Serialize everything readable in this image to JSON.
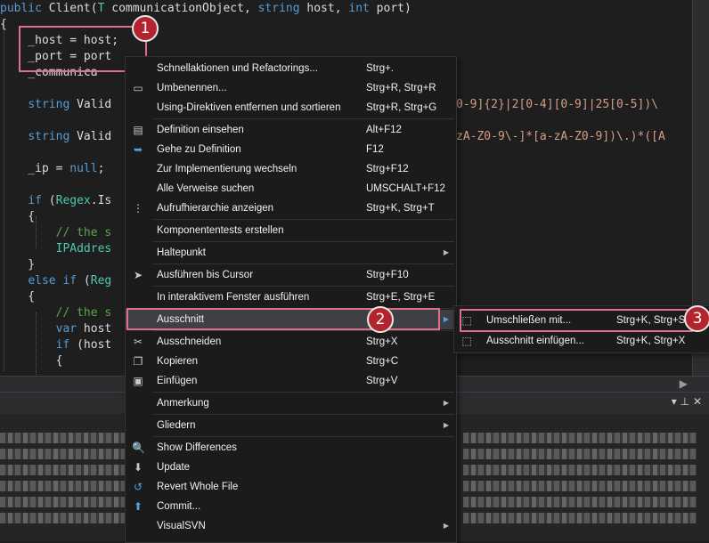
{
  "code": {
    "lines": [
      "public Client(T communicationObject, string host, int port)",
      "{",
      "    _host = host;",
      "    _port = port",
      "    _communica",
      "",
      "    string Valid",
      "",
      "    string Valid",
      "",
      "    _ip = null;",
      "",
      "    if (Regex.Is",
      "    {",
      "        // the s",
      "        IPAddres",
      "    }",
      "    else if (Reg",
      "    {",
      "        // the s",
      "        var host",
      "        if (host",
      "        {"
    ],
    "fragment_regex1": "0-9]{2}|2[0-4][0-9]|25[0-5])\\",
    "fragment_regex2": "zA-Z0-9\\-]*[a-zA-Z0-9])\\.)*([A"
  },
  "context_menu": {
    "items": [
      {
        "label": "Schnellaktionen und Refactorings...",
        "shortcut": "Strg+.",
        "icon": "screwdriver-icon"
      },
      {
        "label": "Umbenennen...",
        "shortcut": "Strg+R, Strg+R",
        "icon": "rename-icon"
      },
      {
        "label": "Using-Direktiven entfernen und sortieren",
        "shortcut": "Strg+R, Strg+G",
        "icon": ""
      },
      {
        "label": "Definition einsehen",
        "shortcut": "Alt+F12",
        "icon": "peek-definition-icon"
      },
      {
        "label": "Gehe zu Definition",
        "shortcut": "F12",
        "icon": "go-to-definition-icon"
      },
      {
        "label": "Zur Implementierung wechseln",
        "shortcut": "Strg+F12",
        "icon": ""
      },
      {
        "label": "Alle Verweise suchen",
        "shortcut": "UMSCHALT+F12",
        "icon": ""
      },
      {
        "label": "Aufrufhierarchie anzeigen",
        "shortcut": "Strg+K, Strg+T",
        "icon": "call-hierarchy-icon"
      },
      {
        "label": "Komponententests erstellen",
        "shortcut": "",
        "icon": ""
      },
      {
        "label": "Haltepunkt",
        "shortcut": "",
        "icon": ""
      },
      {
        "label": "Ausführen bis Cursor",
        "shortcut": "Strg+F10",
        "icon": "cursor-icon"
      },
      {
        "label": "In interaktivem Fenster ausführen",
        "shortcut": "Strg+E, Strg+E",
        "icon": ""
      },
      {
        "label": "Ausschnitt",
        "shortcut": "",
        "icon": ""
      },
      {
        "label": "Ausschneiden",
        "shortcut": "Strg+X",
        "icon": "scissors-icon"
      },
      {
        "label": "Kopieren",
        "shortcut": "Strg+C",
        "icon": "copy-icon"
      },
      {
        "label": "Einfügen",
        "shortcut": "Strg+V",
        "icon": "paste-icon"
      },
      {
        "label": "Anmerkung",
        "shortcut": "",
        "icon": ""
      },
      {
        "label": "Gliedern",
        "shortcut": "",
        "icon": ""
      },
      {
        "label": "Show Differences",
        "shortcut": "",
        "icon": "diff-icon"
      },
      {
        "label": "Update",
        "shortcut": "",
        "icon": "update-icon"
      },
      {
        "label": "Revert Whole File",
        "shortcut": "",
        "icon": "revert-icon"
      },
      {
        "label": "Commit...",
        "shortcut": "",
        "icon": "commit-icon"
      },
      {
        "label": "VisualSVN",
        "shortcut": "",
        "icon": ""
      }
    ]
  },
  "submenu": {
    "items": [
      {
        "label": "Umschließen mit...",
        "shortcut": "Strg+K, Strg+S",
        "icon": "surround-icon"
      },
      {
        "label": "Ausschnitt einfügen...",
        "shortcut": "Strg+K, Strg+X",
        "icon": "insert-snippet-icon"
      }
    ]
  },
  "annotations": {
    "badge1": "1",
    "badge2": "2",
    "badge3": "3"
  },
  "colors": {
    "accent_highlight": "#e0708a",
    "badge": "#b3252e",
    "menu_bg": "#1b1b1c",
    "editor_bg": "#1e1e1e"
  }
}
